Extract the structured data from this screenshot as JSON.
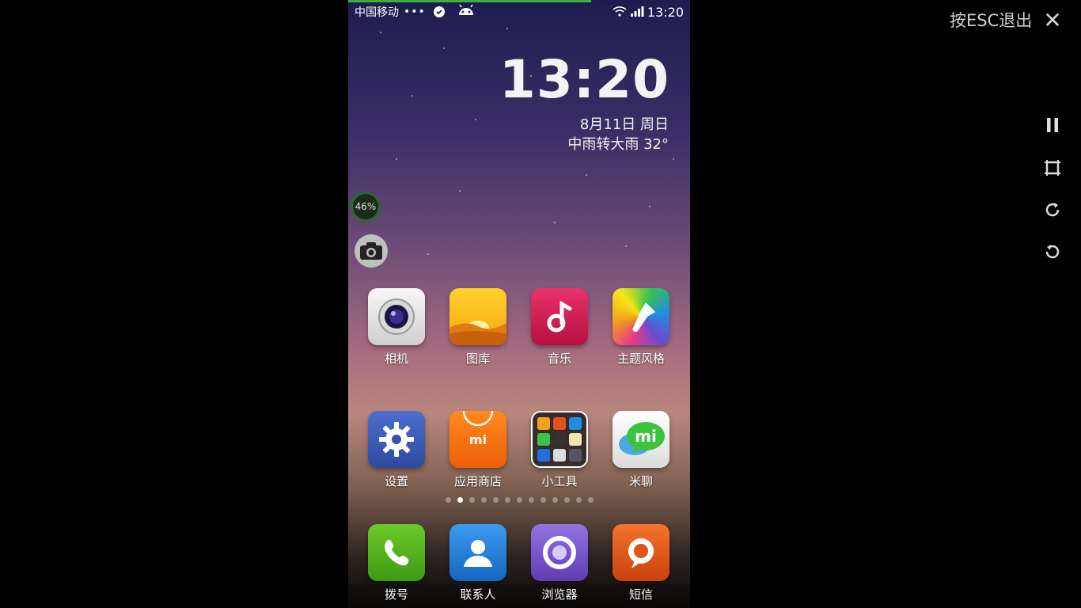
{
  "overlay": {
    "esc_hint": "按ESC退出",
    "close_glyph": "✕"
  },
  "side_controls": [
    {
      "name": "pause-icon"
    },
    {
      "name": "fullscreen-icon"
    },
    {
      "name": "rotate-clockwise-icon"
    },
    {
      "name": "rotate-counterclockwise-icon"
    }
  ],
  "status_bar": {
    "carrier": "中国移动",
    "dots": "•••",
    "time": "13:20"
  },
  "progress_fraction": 0.71,
  "clock_widget": {
    "time": "13:20",
    "date": "8月11日 周日",
    "weather": "中雨转大雨  32°"
  },
  "floating": {
    "memory_percent": "46%"
  },
  "apps_row1": [
    {
      "label": "相机",
      "icon": "camera-app-icon"
    },
    {
      "label": "图库",
      "icon": "gallery-icon"
    },
    {
      "label": "音乐",
      "icon": "music-icon"
    },
    {
      "label": "主题风格",
      "icon": "themes-icon"
    }
  ],
  "apps_row2": [
    {
      "label": "设置",
      "icon": "settings-gear-icon"
    },
    {
      "label": "应用商店",
      "icon": "app-store-icon",
      "mark": "mi"
    },
    {
      "label": "小工具",
      "icon": "tools-folder-icon"
    },
    {
      "label": "米聊",
      "icon": "miliao-chat-icon",
      "mark": "mi"
    }
  ],
  "pager": {
    "count": 13,
    "active": 1
  },
  "dock": [
    {
      "label": "拨号",
      "icon": "phone-dialer-icon"
    },
    {
      "label": "联系人",
      "icon": "contacts-icon"
    },
    {
      "label": "浏览器",
      "icon": "browser-icon"
    },
    {
      "label": "短信",
      "icon": "messages-icon"
    }
  ],
  "colors": {
    "progress": "#3ab13a",
    "dialer": "#4caf1e",
    "contacts": "#1f7fd6",
    "browser": "#7a55c9",
    "messages": "#e2531c",
    "store": "#f26c0d",
    "music": "#d3164e",
    "settings": "#3552a8"
  }
}
